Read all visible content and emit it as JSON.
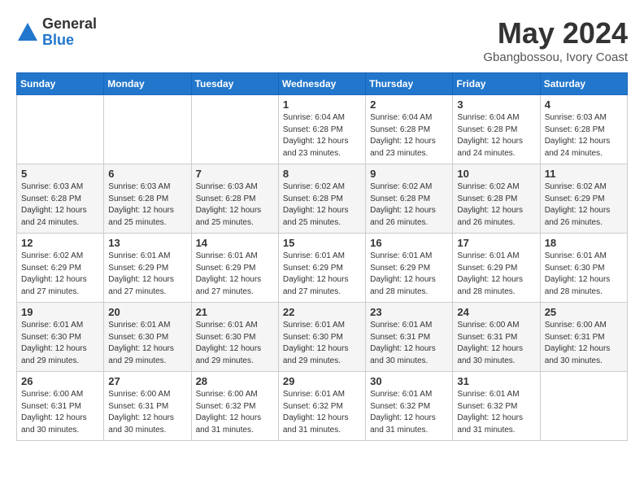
{
  "header": {
    "logo_general": "General",
    "logo_blue": "Blue",
    "month_year": "May 2024",
    "location": "Gbangbossou, Ivory Coast"
  },
  "calendar": {
    "days_of_week": [
      "Sunday",
      "Monday",
      "Tuesday",
      "Wednesday",
      "Thursday",
      "Friday",
      "Saturday"
    ],
    "weeks": [
      [
        {
          "day": "",
          "info": ""
        },
        {
          "day": "",
          "info": ""
        },
        {
          "day": "",
          "info": ""
        },
        {
          "day": "1",
          "info": "Sunrise: 6:04 AM\nSunset: 6:28 PM\nDaylight: 12 hours\nand 23 minutes."
        },
        {
          "day": "2",
          "info": "Sunrise: 6:04 AM\nSunset: 6:28 PM\nDaylight: 12 hours\nand 23 minutes."
        },
        {
          "day": "3",
          "info": "Sunrise: 6:04 AM\nSunset: 6:28 PM\nDaylight: 12 hours\nand 24 minutes."
        },
        {
          "day": "4",
          "info": "Sunrise: 6:03 AM\nSunset: 6:28 PM\nDaylight: 12 hours\nand 24 minutes."
        }
      ],
      [
        {
          "day": "5",
          "info": "Sunrise: 6:03 AM\nSunset: 6:28 PM\nDaylight: 12 hours\nand 24 minutes."
        },
        {
          "day": "6",
          "info": "Sunrise: 6:03 AM\nSunset: 6:28 PM\nDaylight: 12 hours\nand 25 minutes."
        },
        {
          "day": "7",
          "info": "Sunrise: 6:03 AM\nSunset: 6:28 PM\nDaylight: 12 hours\nand 25 minutes."
        },
        {
          "day": "8",
          "info": "Sunrise: 6:02 AM\nSunset: 6:28 PM\nDaylight: 12 hours\nand 25 minutes."
        },
        {
          "day": "9",
          "info": "Sunrise: 6:02 AM\nSunset: 6:28 PM\nDaylight: 12 hours\nand 26 minutes."
        },
        {
          "day": "10",
          "info": "Sunrise: 6:02 AM\nSunset: 6:28 PM\nDaylight: 12 hours\nand 26 minutes."
        },
        {
          "day": "11",
          "info": "Sunrise: 6:02 AM\nSunset: 6:29 PM\nDaylight: 12 hours\nand 26 minutes."
        }
      ],
      [
        {
          "day": "12",
          "info": "Sunrise: 6:02 AM\nSunset: 6:29 PM\nDaylight: 12 hours\nand 27 minutes."
        },
        {
          "day": "13",
          "info": "Sunrise: 6:01 AM\nSunset: 6:29 PM\nDaylight: 12 hours\nand 27 minutes."
        },
        {
          "day": "14",
          "info": "Sunrise: 6:01 AM\nSunset: 6:29 PM\nDaylight: 12 hours\nand 27 minutes."
        },
        {
          "day": "15",
          "info": "Sunrise: 6:01 AM\nSunset: 6:29 PM\nDaylight: 12 hours\nand 27 minutes."
        },
        {
          "day": "16",
          "info": "Sunrise: 6:01 AM\nSunset: 6:29 PM\nDaylight: 12 hours\nand 28 minutes."
        },
        {
          "day": "17",
          "info": "Sunrise: 6:01 AM\nSunset: 6:29 PM\nDaylight: 12 hours\nand 28 minutes."
        },
        {
          "day": "18",
          "info": "Sunrise: 6:01 AM\nSunset: 6:30 PM\nDaylight: 12 hours\nand 28 minutes."
        }
      ],
      [
        {
          "day": "19",
          "info": "Sunrise: 6:01 AM\nSunset: 6:30 PM\nDaylight: 12 hours\nand 29 minutes."
        },
        {
          "day": "20",
          "info": "Sunrise: 6:01 AM\nSunset: 6:30 PM\nDaylight: 12 hours\nand 29 minutes."
        },
        {
          "day": "21",
          "info": "Sunrise: 6:01 AM\nSunset: 6:30 PM\nDaylight: 12 hours\nand 29 minutes."
        },
        {
          "day": "22",
          "info": "Sunrise: 6:01 AM\nSunset: 6:30 PM\nDaylight: 12 hours\nand 29 minutes."
        },
        {
          "day": "23",
          "info": "Sunrise: 6:01 AM\nSunset: 6:31 PM\nDaylight: 12 hours\nand 30 minutes."
        },
        {
          "day": "24",
          "info": "Sunrise: 6:00 AM\nSunset: 6:31 PM\nDaylight: 12 hours\nand 30 minutes."
        },
        {
          "day": "25",
          "info": "Sunrise: 6:00 AM\nSunset: 6:31 PM\nDaylight: 12 hours\nand 30 minutes."
        }
      ],
      [
        {
          "day": "26",
          "info": "Sunrise: 6:00 AM\nSunset: 6:31 PM\nDaylight: 12 hours\nand 30 minutes."
        },
        {
          "day": "27",
          "info": "Sunrise: 6:00 AM\nSunset: 6:31 PM\nDaylight: 12 hours\nand 30 minutes."
        },
        {
          "day": "28",
          "info": "Sunrise: 6:00 AM\nSunset: 6:32 PM\nDaylight: 12 hours\nand 31 minutes."
        },
        {
          "day": "29",
          "info": "Sunrise: 6:01 AM\nSunset: 6:32 PM\nDaylight: 12 hours\nand 31 minutes."
        },
        {
          "day": "30",
          "info": "Sunrise: 6:01 AM\nSunset: 6:32 PM\nDaylight: 12 hours\nand 31 minutes."
        },
        {
          "day": "31",
          "info": "Sunrise: 6:01 AM\nSunset: 6:32 PM\nDaylight: 12 hours\nand 31 minutes."
        },
        {
          "day": "",
          "info": ""
        }
      ]
    ]
  }
}
